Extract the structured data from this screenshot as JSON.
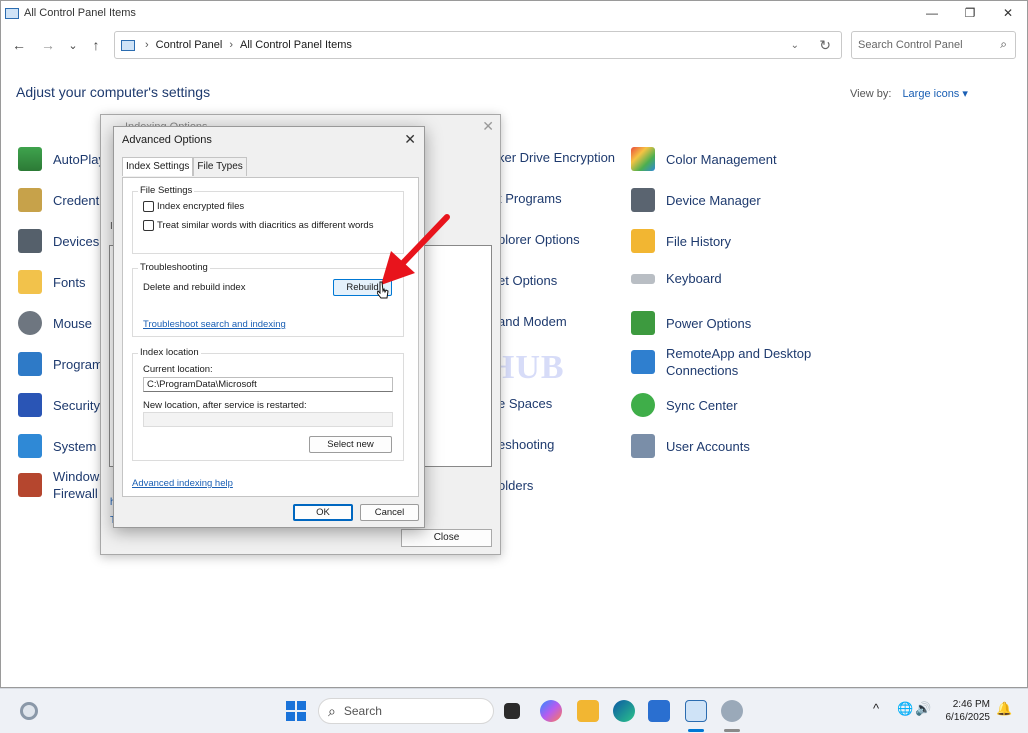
{
  "window": {
    "title": "All Control Panel Items",
    "minimize_glyph": "—",
    "maximize_glyph": "❐",
    "close_glyph": "✕"
  },
  "nav": {
    "back_glyph": "←",
    "forward_glyph": "→",
    "recent_glyph": "⌄",
    "up_glyph": "↑",
    "breadcrumb": [
      "Control Panel",
      "All Control Panel Items"
    ],
    "breadcrumb_sep": "›",
    "dropdown_glyph": "⌄",
    "refresh_glyph": "↻",
    "search_placeholder": "Search Control Panel",
    "search_glyph": "⌕"
  },
  "header": {
    "title": "Adjust your computer's settings",
    "view_by_label": "View by:",
    "view_by_value": "Large icons ▾"
  },
  "items": [
    {
      "label": "AutoPlay",
      "icon": "autoplay-icon"
    },
    {
      "label": "Credenti",
      "icon": "credential-manager-icon"
    },
    {
      "label": "Devices",
      "icon": "devices-printers-icon"
    },
    {
      "label": "Fonts",
      "icon": "fonts-icon"
    },
    {
      "label": "Mouse",
      "icon": "mouse-icon"
    },
    {
      "label": "Program",
      "icon": "programs-icon"
    },
    {
      "label": "Security",
      "icon": "security-flag-icon"
    },
    {
      "label": "System",
      "icon": "system-icon"
    },
    {
      "label": "Windows\nFirewall",
      "icon": "firewall-icon"
    },
    {
      "label": "ker Drive Encryption",
      "icon": ""
    },
    {
      "label": "t Programs",
      "icon": ""
    },
    {
      "label": "plorer Options",
      "icon": ""
    },
    {
      "label": "et Options",
      "icon": ""
    },
    {
      "label": "and Modem",
      "icon": ""
    },
    {
      "label": "e Spaces",
      "icon": ""
    },
    {
      "label": "eshooting",
      "icon": ""
    },
    {
      "label": "olders",
      "icon": ""
    },
    {
      "label": "Color Management",
      "icon": "color-management-icon"
    },
    {
      "label": "Device Manager",
      "icon": "device-manager-icon"
    },
    {
      "label": "File History",
      "icon": "file-history-icon"
    },
    {
      "label": "Keyboard",
      "icon": "keyboard-icon"
    },
    {
      "label": "Power Options",
      "icon": "power-options-icon"
    },
    {
      "label": "RemoteApp and Desktop\nConnections",
      "icon": "remoteapp-icon"
    },
    {
      "label": "Sync Center",
      "icon": "sync-center-icon"
    },
    {
      "label": "User Accounts",
      "icon": "user-accounts-icon"
    }
  ],
  "watermark": "ITPros HUB",
  "indexing_dialog": {
    "title": "Indexing Options",
    "close_glyph": "✕",
    "close_button": "Close",
    "left_fragment_1": "I",
    "left_fragment_2": "h",
    "left_fragment_3": "T"
  },
  "advanced_dialog": {
    "title": "Advanced Options",
    "close_glyph": "✕",
    "tabs": [
      "Index Settings",
      "File Types"
    ],
    "file_settings": {
      "legend": "File Settings",
      "options": [
        {
          "label": "Index encrypted files",
          "checked": false
        },
        {
          "label": "Treat similar words with diacritics as different words",
          "checked": false
        }
      ]
    },
    "troubleshooting": {
      "legend": "Troubleshooting",
      "delete_label": "Delete and rebuild index",
      "rebuild_button": "Rebuild",
      "link": "Troubleshoot search and indexing"
    },
    "index_location": {
      "legend": "Index location",
      "current_label": "Current location:",
      "current_value": "C:\\ProgramData\\Microsoft",
      "new_label": "New location, after service is restarted:",
      "new_value": "",
      "select_button": "Select new"
    },
    "help_link": "Advanced indexing help",
    "ok_button": "OK",
    "cancel_button": "Cancel"
  },
  "taskbar": {
    "search_placeholder": "Search",
    "search_glyph": "⌕",
    "tray_up": "^",
    "clock_time": "2:46 PM",
    "clock_date": "6/16/2025",
    "colors": {
      "start": "#1a73d9",
      "accent": "#0078d4",
      "folder": "#f2b632",
      "arrow": "#e8141c"
    }
  }
}
